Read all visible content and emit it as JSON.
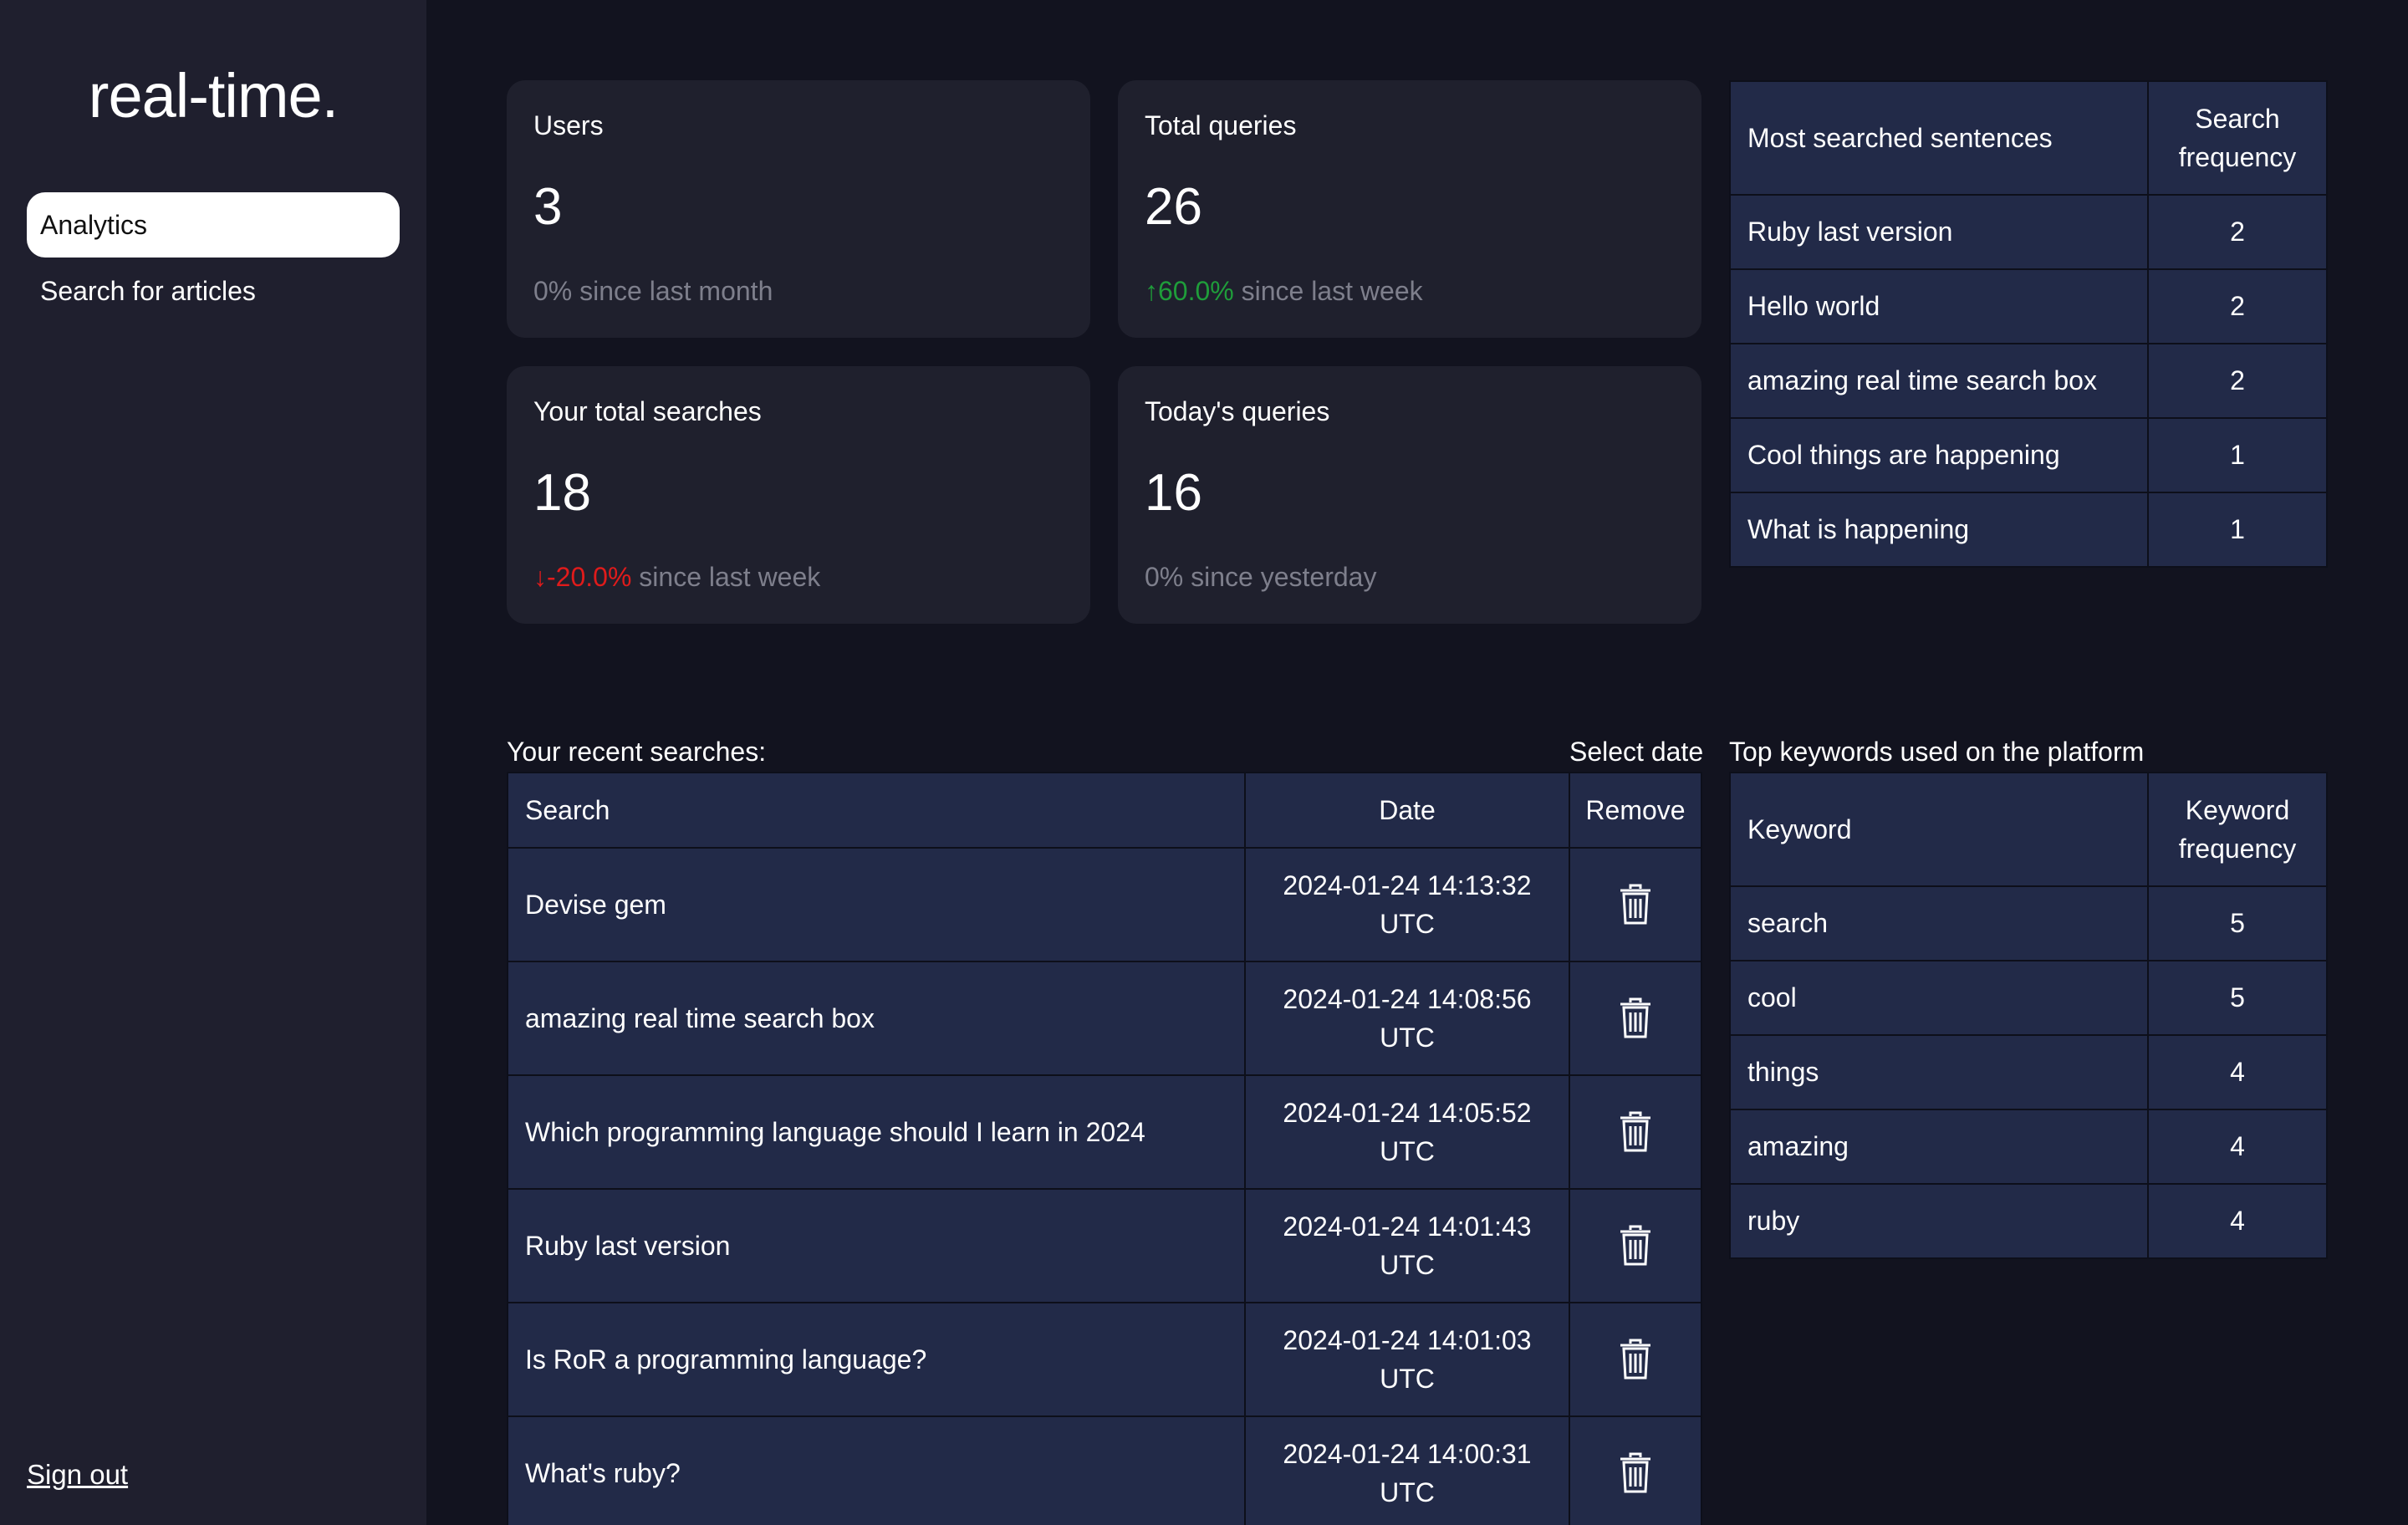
{
  "sidebar": {
    "brand": "real-time.",
    "nav": [
      {
        "label": "Analytics",
        "active": true
      },
      {
        "label": "Search for articles",
        "active": false
      }
    ],
    "sign_out": "Sign out"
  },
  "stats": {
    "users": {
      "label": "Users",
      "value": "3",
      "delta": "0%",
      "delta_text": " since last month"
    },
    "total_queries": {
      "label": "Total queries",
      "value": "26",
      "delta": "↑60.0%",
      "delta_text": " since last week"
    },
    "your_total": {
      "label": "Your total searches",
      "value": "18",
      "delta": "↓-20.0%",
      "delta_text": " since last week"
    },
    "today": {
      "label": "Today's queries",
      "value": "16",
      "delta": "0%",
      "delta_text": " since yesterday"
    }
  },
  "most_searched": {
    "headers": {
      "sentence": "Most searched sentences",
      "freq_line1": "Search",
      "freq_line2": "frequency"
    },
    "rows": [
      {
        "sentence": "Ruby last version",
        "freq": "2"
      },
      {
        "sentence": "Hello world",
        "freq": "2"
      },
      {
        "sentence": "amazing real time search box",
        "freq": "2"
      },
      {
        "sentence": "Cool things are happening",
        "freq": "1"
      },
      {
        "sentence": "What is happening",
        "freq": "1"
      }
    ]
  },
  "recent": {
    "title": "Your recent searches:",
    "select_date": "Select date",
    "headers": {
      "search": "Search",
      "date": "Date",
      "remove": "Remove"
    },
    "rows": [
      {
        "search": "Devise gem",
        "date": "2024-01-24 14:13:32",
        "tz": "UTC"
      },
      {
        "search": "amazing real time search box",
        "date": "2024-01-24 14:08:56",
        "tz": "UTC"
      },
      {
        "search": "Which programming language should I learn in 2024",
        "date": "2024-01-24 14:05:52",
        "tz": "UTC"
      },
      {
        "search": "Ruby last version",
        "date": "2024-01-24 14:01:43",
        "tz": "UTC"
      },
      {
        "search": "Is RoR a programming language?",
        "date": "2024-01-24 14:01:03",
        "tz": "UTC"
      },
      {
        "search": "What's ruby?",
        "date": "2024-01-24 14:00:31",
        "tz": "UTC"
      }
    ]
  },
  "keywords": {
    "title": "Top keywords used on the platform",
    "headers": {
      "keyword": "Keyword",
      "freq_line1": "Keyword",
      "freq_line2": "frequency"
    },
    "rows": [
      {
        "keyword": "search",
        "freq": "5"
      },
      {
        "keyword": "cool",
        "freq": "5"
      },
      {
        "keyword": "things",
        "freq": "4"
      },
      {
        "keyword": "amazing",
        "freq": "4"
      },
      {
        "keyword": "ruby",
        "freq": "4"
      }
    ]
  },
  "colors": {
    "up": "#1f9d3a",
    "down": "#e01b1b",
    "table_bg": "#222a48",
    "card_bg": "#1f202d"
  }
}
